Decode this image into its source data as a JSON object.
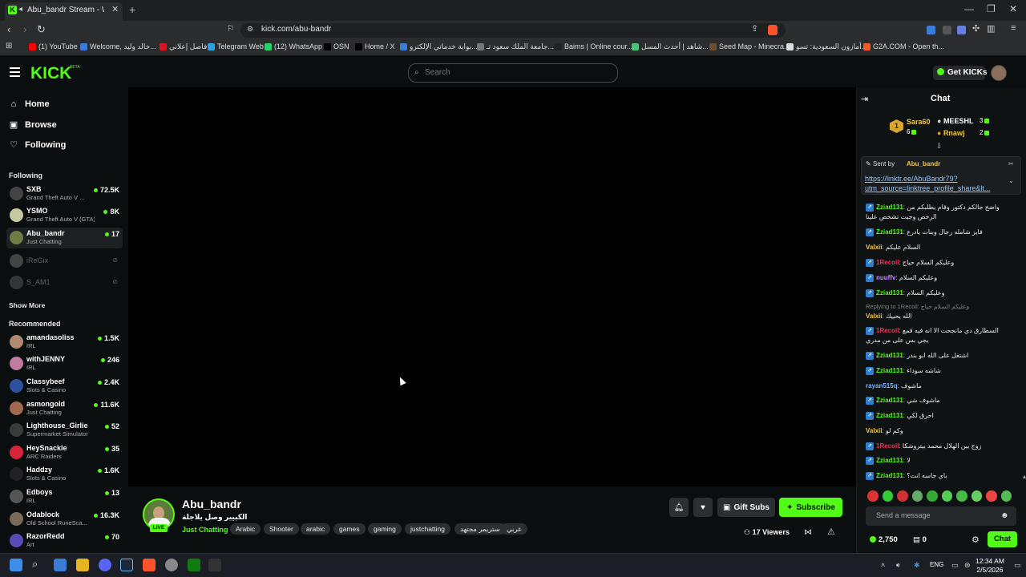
{
  "browser": {
    "tab_title": "Abu_bandr Stream - Watch Live",
    "url": "kick.com/abu-bandr",
    "bookmarks": [
      {
        "label": "(1) YouTube",
        "color": "#ff0000"
      },
      {
        "label": "Welcome, خالد وليد...",
        "color": "#3b7dd8"
      },
      {
        "label": "فاصل إعلاني",
        "color": "#d12"
      },
      {
        "label": "Telegram Web",
        "color": "#2aa3e0"
      },
      {
        "label": "(12) WhatsApp",
        "color": "#25d366"
      },
      {
        "label": "OSN",
        "color": "#000"
      },
      {
        "label": "Home / X",
        "color": "#000"
      },
      {
        "label": "بوابة خدماتي الإلكترو...",
        "color": "#3b7dd8"
      },
      {
        "label": "جامعة الملك سعود تـ...",
        "color": "#777"
      },
      {
        "label": "Baims | Online cour...",
        "color": "#222"
      },
      {
        "label": "شاهد | أحدث المسل...",
        "color": "#4ec07a"
      },
      {
        "label": "Seed Map - Minecra...",
        "color": "#6b4f2c"
      },
      {
        "label": "أمازون السعودية: تسو...",
        "color": "#ddd"
      },
      {
        "label": "G2A.COM - Open th...",
        "color": "#f05a28"
      }
    ]
  },
  "header": {
    "logo": "KICK",
    "logo_beta": "BETA",
    "search_placeholder": "Search",
    "get_kicks": "Get KICKs"
  },
  "sidebar": {
    "nav": [
      {
        "label": "Home",
        "icon": "home-icon",
        "glyph": "⌂"
      },
      {
        "label": "Browse",
        "icon": "browse-icon",
        "glyph": "▣"
      },
      {
        "label": "Following",
        "icon": "heart-icon",
        "glyph": "♡"
      }
    ],
    "following_title": "Following",
    "following": [
      {
        "name": "SXB",
        "category": "Grand Theft Auto V ...",
        "viewers": "72.5K",
        "live": true,
        "avatar": "#444"
      },
      {
        "name": "YSMO",
        "category": "Grand Theft Auto V (GTA)",
        "viewers": "8K",
        "live": true,
        "avatar": "#c8c8a0"
      },
      {
        "name": "Abu_bandr",
        "category": "Just Chatting",
        "viewers": "17",
        "live": true,
        "avatar": "#6d7d45"
      },
      {
        "name": "iReGix",
        "category": "",
        "viewers": "",
        "live": false,
        "avatar": "#888"
      },
      {
        "name": "S_AM1",
        "category": "",
        "viewers": "",
        "live": false,
        "avatar": "#666"
      }
    ],
    "show_more": "Show More",
    "recommended_title": "Recommended",
    "recommended": [
      {
        "name": "amandasoliss",
        "category": "IRL",
        "viewers": "1.5K",
        "avatar": "#b08a6e"
      },
      {
        "name": "withJENNY",
        "category": "IRL",
        "viewers": "246",
        "avatar": "#c07ca0"
      },
      {
        "name": "Classybeef",
        "category": "Slots & Casino",
        "viewers": "2.4K",
        "avatar": "#2f4f9f"
      },
      {
        "name": "asmongold",
        "category": "Just Chatting",
        "viewers": "11.6K",
        "avatar": "#a06a50"
      },
      {
        "name": "Lighthouse_Girlie",
        "category": "Supermarket Simulator",
        "viewers": "52",
        "avatar": "#3a3a3a"
      },
      {
        "name": "HeySnackle",
        "category": "ARC Raiders",
        "viewers": "35",
        "avatar": "#d6243a"
      },
      {
        "name": "Haddzy",
        "category": "Slots & Casino",
        "viewers": "1.6K",
        "avatar": "#222"
      },
      {
        "name": "Edboys",
        "category": "IRL",
        "viewers": "13",
        "avatar": "#555"
      },
      {
        "name": "Odablock",
        "category": "Old School RuneSca...",
        "viewers": "16.3K",
        "avatar": "#7a6a5a"
      },
      {
        "name": "RazorRedd",
        "category": "Art",
        "viewers": "70",
        "avatar": "#5a4ab8"
      }
    ]
  },
  "stream": {
    "streamer": "Abu_bandr",
    "live_label": "LIVE",
    "title": "الكبيير وصل يلاجلة",
    "category": "Just Chatting",
    "tags": [
      "Arabic",
      "Shooter",
      "arabic",
      "games",
      "gaming",
      "justchatting",
      "ستريمر مجتهد",
      "عربي"
    ],
    "gift_subs": "Gift Subs",
    "subscribe": "Subscribe",
    "viewers": "17 Viewers"
  },
  "chat": {
    "title": "Chat",
    "leaderboard": [
      {
        "name": "Sara60",
        "count": "6",
        "color": "#f2c744"
      },
      {
        "name": "MEESHL",
        "count": "3",
        "color": "#fff"
      },
      {
        "name": "Rnawj",
        "count": "2",
        "color": "#f2c744"
      }
    ],
    "rank_badge": "1",
    "pinned_label": "Sent by",
    "pinned_user": "Abu_bandr",
    "pinned_link": "https://linktr.ee/AbuBandr79?utm_source=linktree_profile_share&lt...",
    "messages": [
      {
        "user": "Zziad131",
        "color": "#53fc18",
        "text": "واضح جالكم دكتور وقام يطلبكم من الرخص وجبت تشخص علينا",
        "badge": true
      },
      {
        "user": "Zziad131",
        "color": "#53fc18",
        "text": "فايز شامله رجال وبنات يادرع",
        "badge": true
      },
      {
        "user": "Valxii",
        "color": "#f2c744",
        "text": "السلام عليكم",
        "badge": false
      },
      {
        "user": "1Recoil",
        "color": "#e0385b",
        "text": "وعليكم السلام حياج",
        "badge": true
      },
      {
        "user": "nuuffv",
        "color": "#c488ff",
        "text": "وعليكم السلام",
        "badge": true
      },
      {
        "user": "Zziad131",
        "color": "#53fc18",
        "text": "وعليكم السلام",
        "badge": true
      },
      {
        "user": "Valxii",
        "color": "#f2c744",
        "text": "الله يحييك",
        "badge": false,
        "reply": "Replying to 1Recoil: وعليكم السلام حياج"
      },
      {
        "user": "1Recoil",
        "color": "#e0385b",
        "text": "السطارق دي مانجحت الا انه فيه قمع يجي بس على من مدري",
        "badge": true
      },
      {
        "user": "Zziad131",
        "color": "#53fc18",
        "text": "اشتغل على الله ابو بندر",
        "badge": true
      },
      {
        "user": "Zziad131",
        "color": "#53fc18",
        "text": "شاشه سوداء",
        "badge": true
      },
      {
        "user": "rayan515q",
        "color": "#7fb2ff",
        "text": "ماشوف",
        "badge": false
      },
      {
        "user": "Zziad131",
        "color": "#53fc18",
        "text": "ماشوف شي",
        "badge": true
      },
      {
        "user": "Zziad131",
        "color": "#53fc18",
        "text": "احرق لكي",
        "badge": true
      },
      {
        "user": "Valxii",
        "color": "#f2c744",
        "text": "وكم لو",
        "badge": false
      },
      {
        "user": "1Recoil",
        "color": "#e0385b",
        "text": "زوج بين الهلال محمد بيتروشكا",
        "badge": true
      },
      {
        "user": "Zziad131",
        "color": "#53fc18",
        "text": "لا",
        "badge": true
      },
      {
        "user": "Zziad131",
        "color": "#53fc18",
        "text": "باي جاسه انت؟",
        "badge": true
      }
    ],
    "input_placeholder": "Send a message",
    "kicks": "2,750",
    "subs": "0",
    "send": "Chat"
  },
  "taskbar": {
    "lang": "ENG",
    "time": "12:34 AM",
    "date": "2/5/2026"
  }
}
